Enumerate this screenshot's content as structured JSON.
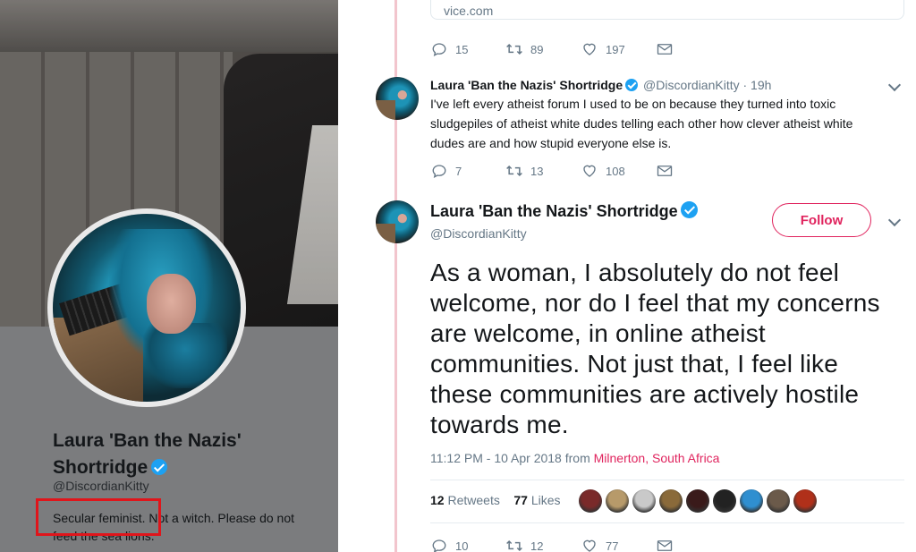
{
  "profile": {
    "name": "Laura 'Ban the Nazis' Shortridge",
    "handle": "@DiscordianKitty",
    "bio": "Secular feminist. Not a witch. Please do not feed the sea lions."
  },
  "link_card": {
    "domain": "vice.com"
  },
  "tweet1_actions": {
    "replies": "15",
    "retweets": "89",
    "likes": "197"
  },
  "tweet2": {
    "name": "Laura 'Ban the Nazis' Shortridge",
    "handle": "@DiscordianKitty",
    "time": "· 19h",
    "text": "I've left every atheist forum I used to be on because they turned into toxic sludgepiles of atheist white dudes telling each other how clever atheist white dudes are and how stupid everyone else is.",
    "replies": "7",
    "retweets": "13",
    "likes": "108"
  },
  "tweet3": {
    "name": "Laura 'Ban the Nazis' Shortridge",
    "handle": "@DiscordianKitty",
    "follow_label": "Follow",
    "text": "As a woman, I absolutely do not feel welcome, nor do I feel that my concerns are welcome, in online atheist communities. Not just that, I feel like these communities are actively hostile towards me.",
    "timestamp": "11:12 PM - 10 Apr 2018 from",
    "location": "Milnerton, South Africa",
    "retweet_count": "12",
    "retweet_label": "Retweets",
    "like_count": "77",
    "like_label": "Likes",
    "replies": "10",
    "retweets": "12",
    "likes": "77"
  },
  "colors": {
    "accent": "#e0245e",
    "verified": "#1da1f2",
    "thread_line": "#f2c5cd",
    "highlight": "#e0151b"
  },
  "likers": [
    "#7a2a2a",
    "#b79a6a",
    "#c9c9c9",
    "#8a6a3a",
    "#3a1a1a",
    "#222222",
    "#2f8fd0",
    "#6b5a4a",
    "#b0301a"
  ]
}
